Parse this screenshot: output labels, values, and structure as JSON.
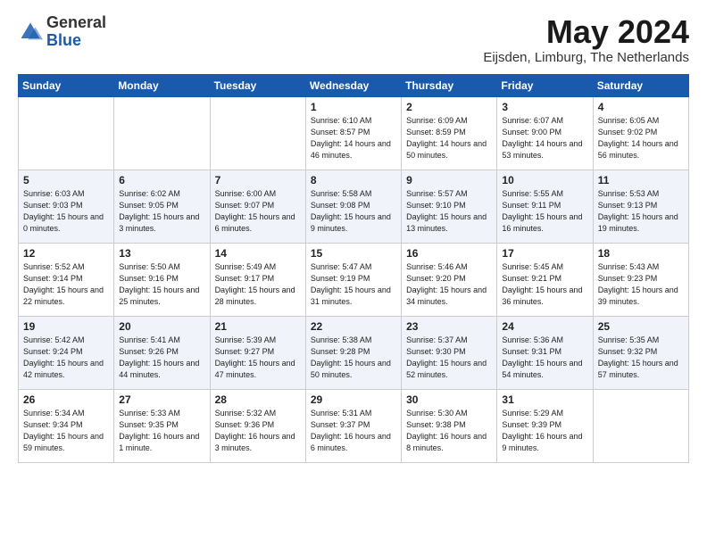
{
  "logo": {
    "general": "General",
    "blue": "Blue"
  },
  "title": "May 2024",
  "subtitle": "Eijsden, Limburg, The Netherlands",
  "days_of_week": [
    "Sunday",
    "Monday",
    "Tuesday",
    "Wednesday",
    "Thursday",
    "Friday",
    "Saturday"
  ],
  "weeks": [
    [
      {
        "num": "",
        "info": ""
      },
      {
        "num": "",
        "info": ""
      },
      {
        "num": "",
        "info": ""
      },
      {
        "num": "1",
        "info": "Sunrise: 6:10 AM\nSunset: 8:57 PM\nDaylight: 14 hours\nand 46 minutes."
      },
      {
        "num": "2",
        "info": "Sunrise: 6:09 AM\nSunset: 8:59 PM\nDaylight: 14 hours\nand 50 minutes."
      },
      {
        "num": "3",
        "info": "Sunrise: 6:07 AM\nSunset: 9:00 PM\nDaylight: 14 hours\nand 53 minutes."
      },
      {
        "num": "4",
        "info": "Sunrise: 6:05 AM\nSunset: 9:02 PM\nDaylight: 14 hours\nand 56 minutes."
      }
    ],
    [
      {
        "num": "5",
        "info": "Sunrise: 6:03 AM\nSunset: 9:03 PM\nDaylight: 15 hours\nand 0 minutes."
      },
      {
        "num": "6",
        "info": "Sunrise: 6:02 AM\nSunset: 9:05 PM\nDaylight: 15 hours\nand 3 minutes."
      },
      {
        "num": "7",
        "info": "Sunrise: 6:00 AM\nSunset: 9:07 PM\nDaylight: 15 hours\nand 6 minutes."
      },
      {
        "num": "8",
        "info": "Sunrise: 5:58 AM\nSunset: 9:08 PM\nDaylight: 15 hours\nand 9 minutes."
      },
      {
        "num": "9",
        "info": "Sunrise: 5:57 AM\nSunset: 9:10 PM\nDaylight: 15 hours\nand 13 minutes."
      },
      {
        "num": "10",
        "info": "Sunrise: 5:55 AM\nSunset: 9:11 PM\nDaylight: 15 hours\nand 16 minutes."
      },
      {
        "num": "11",
        "info": "Sunrise: 5:53 AM\nSunset: 9:13 PM\nDaylight: 15 hours\nand 19 minutes."
      }
    ],
    [
      {
        "num": "12",
        "info": "Sunrise: 5:52 AM\nSunset: 9:14 PM\nDaylight: 15 hours\nand 22 minutes."
      },
      {
        "num": "13",
        "info": "Sunrise: 5:50 AM\nSunset: 9:16 PM\nDaylight: 15 hours\nand 25 minutes."
      },
      {
        "num": "14",
        "info": "Sunrise: 5:49 AM\nSunset: 9:17 PM\nDaylight: 15 hours\nand 28 minutes."
      },
      {
        "num": "15",
        "info": "Sunrise: 5:47 AM\nSunset: 9:19 PM\nDaylight: 15 hours\nand 31 minutes."
      },
      {
        "num": "16",
        "info": "Sunrise: 5:46 AM\nSunset: 9:20 PM\nDaylight: 15 hours\nand 34 minutes."
      },
      {
        "num": "17",
        "info": "Sunrise: 5:45 AM\nSunset: 9:21 PM\nDaylight: 15 hours\nand 36 minutes."
      },
      {
        "num": "18",
        "info": "Sunrise: 5:43 AM\nSunset: 9:23 PM\nDaylight: 15 hours\nand 39 minutes."
      }
    ],
    [
      {
        "num": "19",
        "info": "Sunrise: 5:42 AM\nSunset: 9:24 PM\nDaylight: 15 hours\nand 42 minutes."
      },
      {
        "num": "20",
        "info": "Sunrise: 5:41 AM\nSunset: 9:26 PM\nDaylight: 15 hours\nand 44 minutes."
      },
      {
        "num": "21",
        "info": "Sunrise: 5:39 AM\nSunset: 9:27 PM\nDaylight: 15 hours\nand 47 minutes."
      },
      {
        "num": "22",
        "info": "Sunrise: 5:38 AM\nSunset: 9:28 PM\nDaylight: 15 hours\nand 50 minutes."
      },
      {
        "num": "23",
        "info": "Sunrise: 5:37 AM\nSunset: 9:30 PM\nDaylight: 15 hours\nand 52 minutes."
      },
      {
        "num": "24",
        "info": "Sunrise: 5:36 AM\nSunset: 9:31 PM\nDaylight: 15 hours\nand 54 minutes."
      },
      {
        "num": "25",
        "info": "Sunrise: 5:35 AM\nSunset: 9:32 PM\nDaylight: 15 hours\nand 57 minutes."
      }
    ],
    [
      {
        "num": "26",
        "info": "Sunrise: 5:34 AM\nSunset: 9:34 PM\nDaylight: 15 hours\nand 59 minutes."
      },
      {
        "num": "27",
        "info": "Sunrise: 5:33 AM\nSunset: 9:35 PM\nDaylight: 16 hours\nand 1 minute."
      },
      {
        "num": "28",
        "info": "Sunrise: 5:32 AM\nSunset: 9:36 PM\nDaylight: 16 hours\nand 3 minutes."
      },
      {
        "num": "29",
        "info": "Sunrise: 5:31 AM\nSunset: 9:37 PM\nDaylight: 16 hours\nand 6 minutes."
      },
      {
        "num": "30",
        "info": "Sunrise: 5:30 AM\nSunset: 9:38 PM\nDaylight: 16 hours\nand 8 minutes."
      },
      {
        "num": "31",
        "info": "Sunrise: 5:29 AM\nSunset: 9:39 PM\nDaylight: 16 hours\nand 9 minutes."
      },
      {
        "num": "",
        "info": ""
      }
    ]
  ]
}
